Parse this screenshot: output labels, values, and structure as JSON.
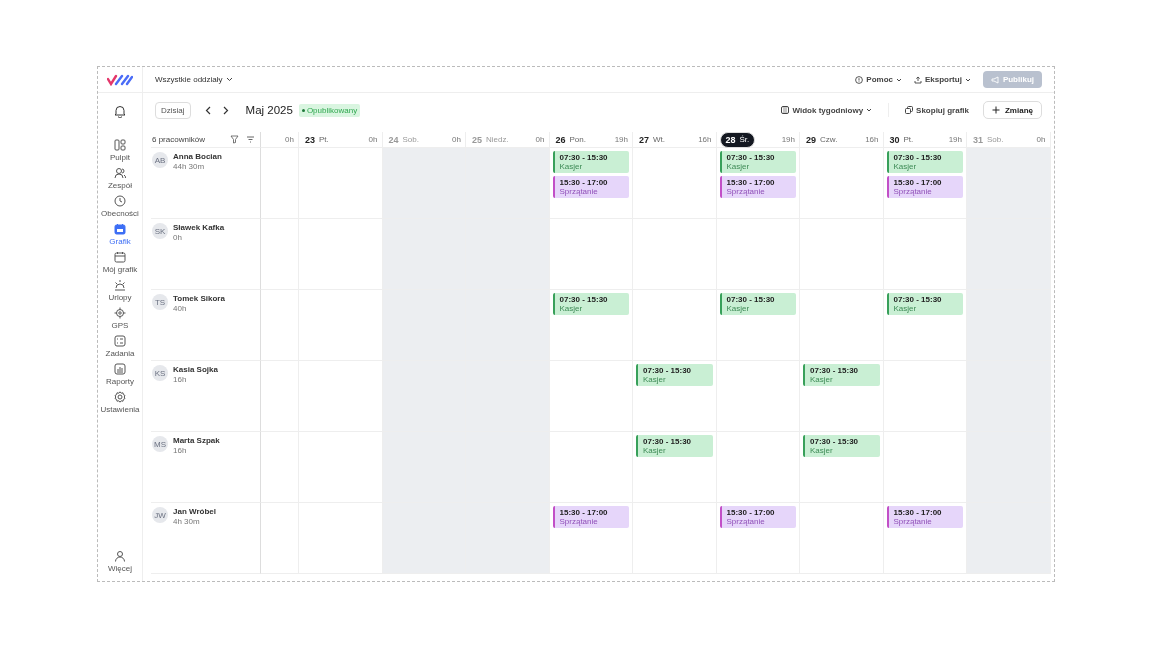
{
  "branch_selector": "Wszystkie oddziały",
  "top_actions": [
    {
      "label": "Pomoc",
      "kind": "help",
      "disabled": false
    },
    {
      "label": "Eksportuj",
      "kind": "export",
      "disabled": false
    },
    {
      "label": "Publikuj",
      "kind": "publish",
      "disabled": true
    }
  ],
  "sidebar": {
    "items": [
      {
        "label": "Pulpit",
        "selected": false
      },
      {
        "label": "Zespół",
        "selected": false
      },
      {
        "label": "Obecności",
        "selected": false
      },
      {
        "label": "Grafik",
        "selected": true
      },
      {
        "label": "Mój grafik",
        "selected": false
      },
      {
        "label": "Urlopy",
        "selected": false
      },
      {
        "label": "GPS",
        "selected": false
      },
      {
        "label": "Zadania",
        "selected": false
      },
      {
        "label": "Raporty",
        "selected": false
      },
      {
        "label": "Ustawienia",
        "selected": false
      }
    ],
    "more": "Więcej"
  },
  "toolbar": {
    "today_button": "Dzisiaj",
    "period": "Maj 2025",
    "status": "Opublikowany",
    "view": "Widok tygodniowy",
    "copy": "Skopiuj grafik",
    "add": "Zmianę"
  },
  "employee_count": "6 pracowników",
  "days": [
    {
      "hours": "0h",
      "weekend": false
    },
    {
      "number": "23",
      "weekday": "Pt.",
      "hours": "0h",
      "weekend": false,
      "today": false
    },
    {
      "number": "24",
      "weekday": "Sob.",
      "hours": "0h",
      "weekend": true,
      "today": false
    },
    {
      "number": "25",
      "weekday": "Niedz.",
      "hours": "0h",
      "weekend": true,
      "today": false
    },
    {
      "number": "26",
      "weekday": "Pon.",
      "hours": "19h",
      "weekend": false,
      "today": false
    },
    {
      "number": "27",
      "weekday": "Wt.",
      "hours": "16h",
      "weekend": false,
      "today": false
    },
    {
      "number": "28",
      "weekday": "Śr.",
      "hours": "19h",
      "weekend": false,
      "today": true
    },
    {
      "number": "29",
      "weekday": "Czw.",
      "hours": "16h",
      "weekend": false,
      "today": false
    },
    {
      "number": "30",
      "weekday": "Pt.",
      "hours": "19h",
      "weekend": false,
      "today": false
    },
    {
      "number": "31",
      "weekday": "Sob.",
      "hours": "0h",
      "weekend": true,
      "today": false
    }
  ],
  "employees": [
    {
      "initials": "AB",
      "name": "Anna Bocian",
      "hours": "44h 30m",
      "days": [
        {
          "kind": "free"
        },
        {
          "kind": "free"
        },
        {
          "kind": "free"
        },
        {
          "kind": "free"
        },
        {
          "kind": "shifts",
          "shifts": [
            {
              "time": "07:30 - 15:30",
              "role": "Kasjer",
              "kind": "work"
            },
            {
              "time": "15:30 - 17:00",
              "role": "Sprzątanie",
              "kind": "cleaning"
            }
          ]
        },
        {
          "kind": "free"
        },
        {
          "kind": "shifts",
          "shifts": [
            {
              "time": "07:30 - 15:30",
              "role": "Kasjer",
              "kind": "work"
            },
            {
              "time": "15:30 - 17:00",
              "role": "Sprzątanie",
              "kind": "cleaning"
            }
          ]
        },
        {
          "kind": "free"
        },
        {
          "kind": "shifts",
          "shifts": [
            {
              "time": "07:30 - 15:30",
              "role": "Kasjer",
              "kind": "work"
            },
            {
              "time": "15:30 - 17:00",
              "role": "Sprzątanie",
              "kind": "cleaning"
            }
          ]
        },
        {
          "kind": "free"
        }
      ]
    },
    {
      "initials": "SK",
      "name": "Sławek Kafka",
      "hours": "0h",
      "days": [
        {
          "kind": "free"
        },
        {
          "kind": "free"
        },
        {
          "kind": "free"
        },
        {
          "kind": "free"
        },
        {
          "kind": "free"
        },
        {
          "kind": "free"
        },
        {
          "kind": "free"
        },
        {
          "kind": "free"
        },
        {
          "kind": "free"
        },
        {
          "kind": "free"
        }
      ]
    },
    {
      "initials": "TS",
      "name": "Tomek Sikora",
      "hours": "40h",
      "days": [
        {
          "kind": "free"
        },
        {
          "kind": "free"
        },
        {
          "kind": "free"
        },
        {
          "kind": "free"
        },
        {
          "kind": "shifts",
          "shifts": [
            {
              "time": "07:30 - 15:30",
              "role": "Kasjer",
              "kind": "work"
            }
          ]
        },
        {
          "kind": "free"
        },
        {
          "kind": "shifts",
          "shifts": [
            {
              "time": "07:30 - 15:30",
              "role": "Kasjer",
              "kind": "work"
            }
          ]
        },
        {
          "kind": "free"
        },
        {
          "kind": "shifts",
          "shifts": [
            {
              "time": "07:30 - 15:30",
              "role": "Kasjer",
              "kind": "work"
            }
          ]
        },
        {
          "kind": "free"
        }
      ]
    },
    {
      "initials": "KS",
      "name": "Kasia Sojka",
      "hours": "16h",
      "days": [
        {
          "kind": "free"
        },
        {
          "kind": "free"
        },
        {
          "kind": "free"
        },
        {
          "kind": "free"
        },
        {
          "kind": "free"
        },
        {
          "kind": "shifts",
          "shifts": [
            {
              "time": "07:30 - 15:30",
              "role": "Kasjer",
              "kind": "work"
            }
          ]
        },
        {
          "kind": "free"
        },
        {
          "kind": "shifts",
          "shifts": [
            {
              "time": "07:30 - 15:30",
              "role": "Kasjer",
              "kind": "work"
            }
          ]
        },
        {
          "kind": "free"
        },
        {
          "kind": "free"
        }
      ]
    },
    {
      "initials": "MS",
      "name": "Marta Szpak",
      "hours": "16h",
      "days": [
        {
          "kind": "free"
        },
        {
          "kind": "free"
        },
        {
          "kind": "free"
        },
        {
          "kind": "free"
        },
        {
          "kind": "free"
        },
        {
          "kind": "shifts",
          "shifts": [
            {
              "time": "07:30 - 15:30",
              "role": "Kasjer",
              "kind": "work"
            }
          ]
        },
        {
          "kind": "free"
        },
        {
          "kind": "shifts",
          "shifts": [
            {
              "time": "07:30 - 15:30",
              "role": "Kasjer",
              "kind": "work"
            }
          ]
        },
        {
          "kind": "free"
        },
        {
          "kind": "free"
        }
      ]
    },
    {
      "initials": "JW",
      "name": "Jan Wróbel",
      "hours": "4h 30m",
      "days": [
        {
          "kind": "free"
        },
        {
          "kind": "free"
        },
        {
          "kind": "free"
        },
        {
          "kind": "free"
        },
        {
          "kind": "shifts",
          "shifts": [
            {
              "time": "15:30 - 17:00",
              "role": "Sprzątanie",
              "kind": "cleaning"
            }
          ]
        },
        {
          "kind": "free"
        },
        {
          "kind": "shifts",
          "shifts": [
            {
              "time": "15:30 - 17:00",
              "role": "Sprzątanie",
              "kind": "cleaning"
            }
          ]
        },
        {
          "kind": "free"
        },
        {
          "kind": "shifts",
          "shifts": [
            {
              "time": "15:30 - 17:00",
              "role": "Sprzątanie",
              "kind": "cleaning"
            }
          ]
        },
        {
          "kind": "free"
        }
      ]
    }
  ]
}
